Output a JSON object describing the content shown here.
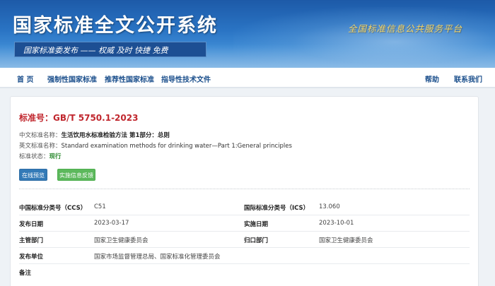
{
  "banner": {
    "title": "国家标准全文公开系统",
    "slogan": "国家标准委发布 —— 权威  及时  快捷  免费",
    "platform": "全国标准信息公共服务平台"
  },
  "nav": {
    "items": [
      "首 页",
      "强制性国家标准",
      "推荐性国家标准",
      "指导性技术文件"
    ],
    "right": [
      "帮助",
      "联系我们"
    ]
  },
  "standard": {
    "number_label": "标准号：",
    "number": "GB/T 5750.1-2023",
    "cn_name_label": "中文标准名称：",
    "cn_name": "生活饮用水标准检验方法 第1部分：总则",
    "en_name_label": "英文标准名称：",
    "en_name": "Standard examination methods for drinking water—Part 1:General principles",
    "status_label": "标准状态：",
    "status": "现行"
  },
  "buttons": {
    "preview": "在线预览",
    "feedback": "实施信息反馈"
  },
  "details": [
    {
      "label1": "中国标准分类号（CCS）",
      "value1": "C51",
      "label2": "国际标准分类号（ICS）",
      "value2": "13.060"
    },
    {
      "label1": "发布日期",
      "value1": "2023-03-17",
      "label2": "实施日期",
      "value2": "2023-10-01"
    },
    {
      "label1": "主管部门",
      "value1": "国家卫生健康委员会",
      "label2": "归口部门",
      "value2": "国家卫生健康委员会"
    },
    {
      "label1": "发布单位",
      "value1": "国家市场监督管理总局、国家标准化管理委员会",
      "label2": "",
      "value2": ""
    },
    {
      "label1": "备注",
      "value1": "",
      "label2": "",
      "value2": ""
    }
  ]
}
